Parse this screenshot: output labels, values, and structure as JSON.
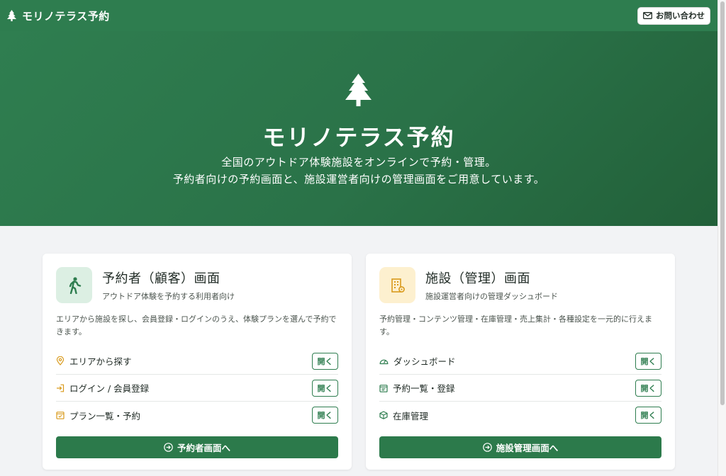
{
  "header": {
    "brand": "モリノテラス予約",
    "contact_label": "お問い合わせ"
  },
  "hero": {
    "title": "モリノテラス予約",
    "line1": "全国のアウトドア体験施設をオンラインで予約・管理。",
    "line2": "予約者向けの予約画面と、施設運営者向けの管理画面をご用意しています。"
  },
  "customer_card": {
    "title": "予約者（顧客）画面",
    "subtitle": "アウトドア体験を予約する利用者向け",
    "description": "エリアから施設を探し、会員登録・ログインのうえ、体験プランを選んで予約できます。",
    "links": [
      {
        "label": "エリアから探す",
        "icon": "map-pin-icon",
        "button": "開く"
      },
      {
        "label": "ログイン / 会員登録",
        "icon": "login-icon",
        "button": "開く"
      },
      {
        "label": "プラン一覧・予約",
        "icon": "calendar-check-icon",
        "button": "開く"
      }
    ],
    "primary_label": "予約者画面へ"
  },
  "admin_card": {
    "title": "施設（管理）画面",
    "subtitle": "施設運営者向けの管理ダッシュボード",
    "description": "予約管理・コンテンツ管理・在庫管理・売上集計・各種設定を一元的に行えます。",
    "links": [
      {
        "label": "ダッシュボード",
        "icon": "gauge-icon",
        "button": "開く"
      },
      {
        "label": "予約一覧・登録",
        "icon": "calendar-list-icon",
        "button": "開く"
      },
      {
        "label": "在庫管理",
        "icon": "box-icon",
        "button": "開く"
      }
    ],
    "primary_label": "施設管理画面へ"
  },
  "colors": {
    "brand_green": "#2e7d4f",
    "accent_amber": "#d99a1c",
    "icon_bg_green": "#dcefe3",
    "icon_bg_amber": "#fdf0cf"
  }
}
